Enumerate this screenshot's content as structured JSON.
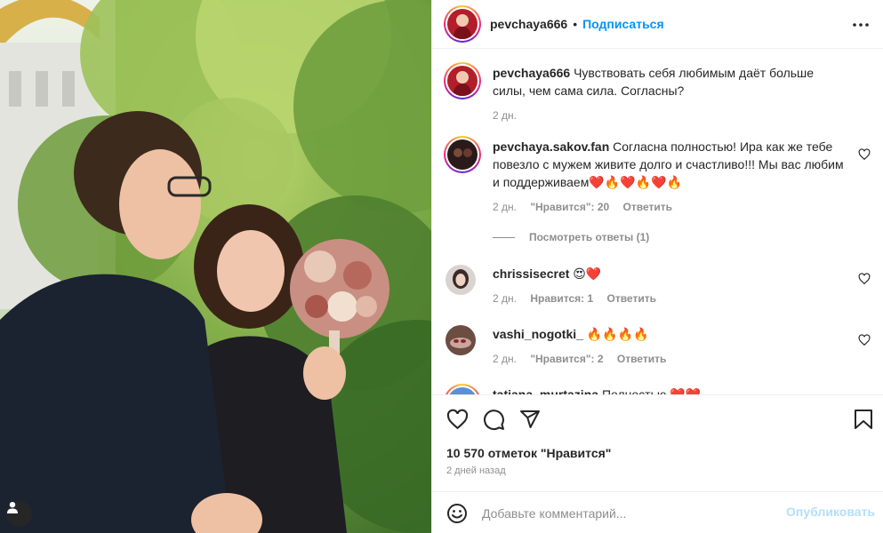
{
  "post": {
    "author": "pevchaya666",
    "follow_label": "Подписаться",
    "dot": "•",
    "icons": {
      "more": "more-options-icon",
      "like": "heart-icon",
      "comment": "comment-icon",
      "share": "share-icon",
      "save": "bookmark-icon",
      "emoji": "emoji-icon",
      "tagged_user": "user-icon"
    }
  },
  "caption": {
    "username": "pevchaya666",
    "text": "Чувствовать себя любимым даёт больше силы, чем сама сила. Согласны?",
    "time": "2 дн."
  },
  "comments": [
    {
      "username": "pevchaya.sakov.fan",
      "text": "Согласна полностью! Ира как же тебе повезло с мужем живите долго и счастливо!!! Мы вас любим и поддерживаем❤️🔥❤️🔥❤️🔥",
      "time": "2 дн.",
      "likes": "\"Нравится\": 20",
      "reply": "Ответить",
      "view_replies": "Посмотреть ответы (1)"
    },
    {
      "username": "chrissisecret",
      "text": "😍❤️",
      "time": "2 дн.",
      "likes": "Нравится: 1",
      "reply": "Ответить"
    },
    {
      "username": "vashi_nogotki_",
      "text": "🔥🔥🔥🔥",
      "time": "2 дн.",
      "likes": "\"Нравится\": 2",
      "reply": "Ответить"
    },
    {
      "username": "tatiana_murtazina",
      "text": "Полностью ❤️❤️"
    }
  ],
  "stats": {
    "likes": "10 570 отметок \"Нравится\"",
    "time_ago": "2 дней назад"
  },
  "composer": {
    "placeholder": "Добавьте комментарий...",
    "publish_label": "Опубликовать"
  },
  "colors": {
    "accent": "#0095f6",
    "publish_disabled": "#b2dffc",
    "muted": "#8e8e8e",
    "text": "#262626"
  }
}
